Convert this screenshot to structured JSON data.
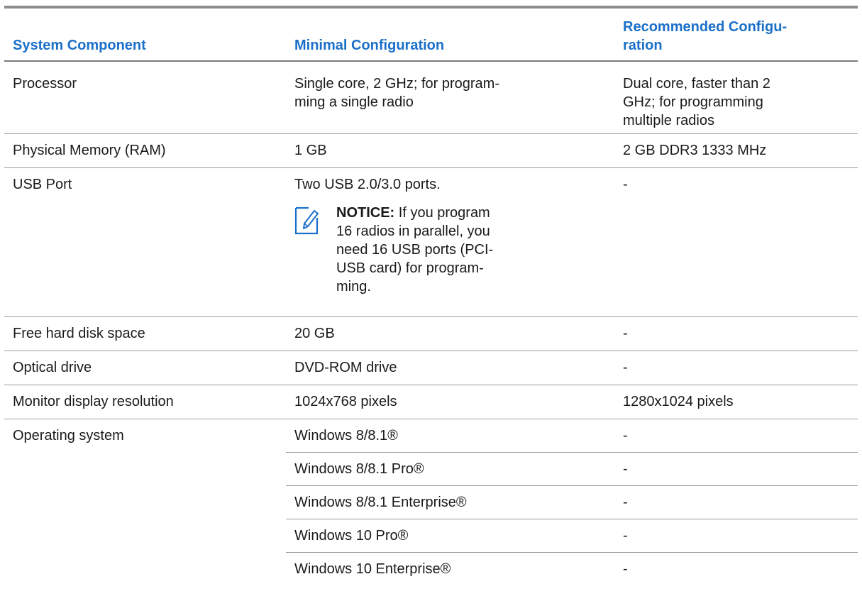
{
  "table": {
    "headers": {
      "component": "System Component",
      "minimal": "Minimal Configuration",
      "recommended": "Recommended Configu-\nration"
    },
    "rows": [
      {
        "component": "Processor",
        "minimal": "Single core, 2 GHz; for program-\nming a single radio",
        "recommended": "Dual core, faster than 2\nGHz; for programming\nmultiple radios"
      },
      {
        "component": "Physical Memory (RAM)",
        "minimal": "1 GB",
        "recommended": "2 GB DDR3 1333 MHz"
      },
      {
        "component": "USB Port",
        "minimal": "Two USB 2.0/3.0 ports.",
        "recommended": "-",
        "notice": {
          "icon": "pencil-note-icon",
          "label": "NOTICE:",
          "text": " If you program\n16 radios in parallel, you\nneed 16 USB ports (PCI-\nUSB card) for program-\nming."
        }
      },
      {
        "component": "Free hard disk space",
        "minimal": "20 GB",
        "recommended": "-"
      },
      {
        "component": "Optical drive",
        "minimal": "DVD-ROM drive",
        "recommended": "-"
      },
      {
        "component": "Monitor display resolution",
        "minimal": "1024x768 pixels",
        "recommended": "1280x1024 pixels"
      }
    ],
    "os": {
      "component": "Operating system",
      "versions": [
        {
          "minimal": "Windows 8/8.1®",
          "recommended": "-"
        },
        {
          "minimal": "Windows 8/8.1 Pro®",
          "recommended": "-"
        },
        {
          "minimal": "Windows 8/8.1 Enterprise®",
          "recommended": "-"
        },
        {
          "minimal": "Windows 10 Pro®",
          "recommended": "-"
        },
        {
          "minimal": "Windows 10 Enterprise®",
          "recommended": "-"
        }
      ]
    }
  },
  "colors": {
    "header_text": "#1a6fc9",
    "rule": "#8c8c8c",
    "notice_icon": "#1a6fc9"
  }
}
